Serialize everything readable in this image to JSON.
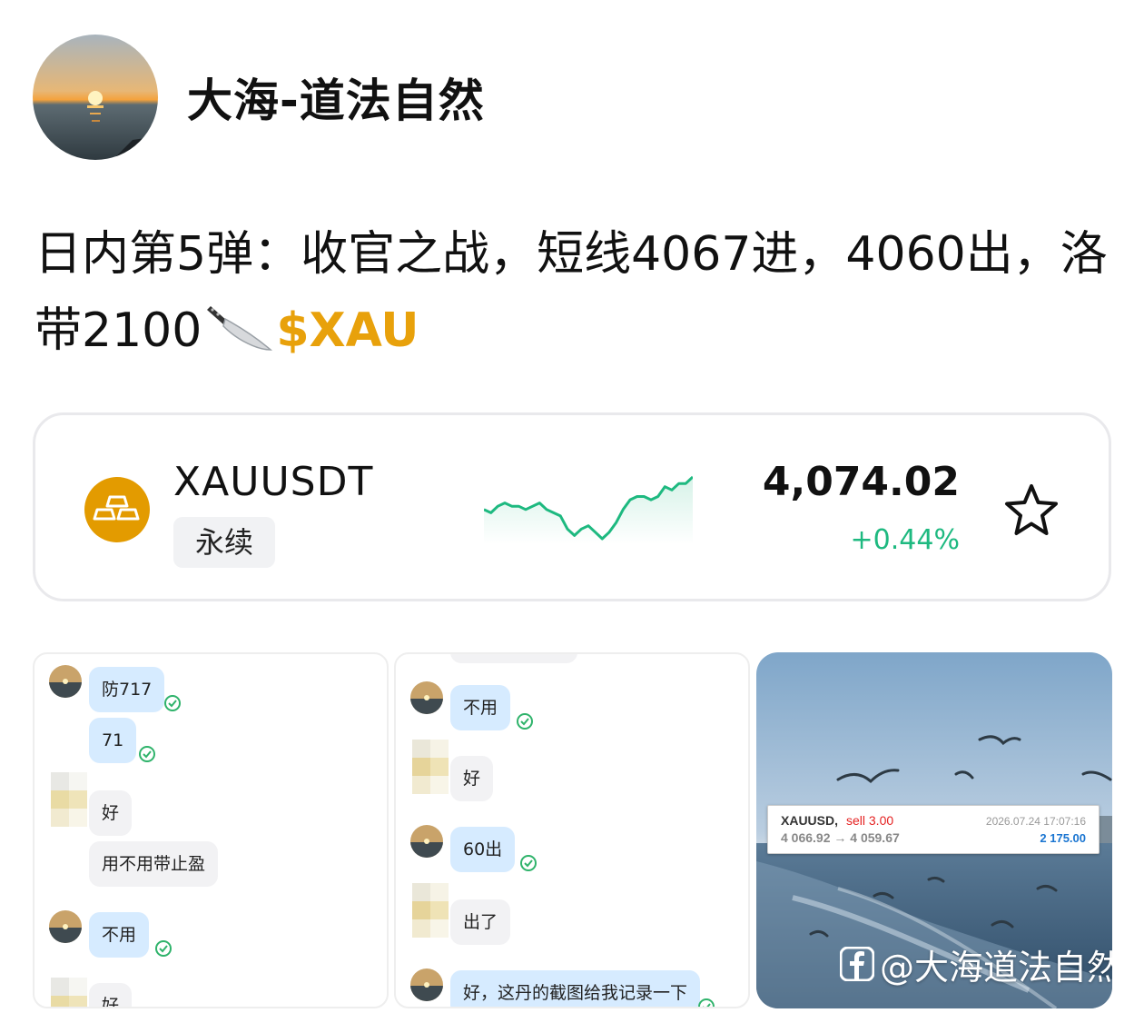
{
  "author": {
    "name": "大海-道法自然",
    "avatar_icon": "sunset-avatar"
  },
  "post": {
    "text": "日内第5弹：收官之战，短线4067进，4060出，洛带2100",
    "emoji": "kitchen-knife-icon",
    "ticker_link": "$XAU"
  },
  "ticker_card": {
    "icon": "gold-bars-icon",
    "symbol": "XAUUSDT",
    "tag": "永续",
    "price": "4,074.02",
    "change": "+0.44%",
    "sparkline_color": "#1eb980",
    "sparkline": [
      4073.6,
      4073.5,
      4073.7,
      4073.8,
      4073.7,
      4073.7,
      4073.6,
      4073.7,
      4073.8,
      4073.6,
      4073.5,
      4073.4,
      4073.0,
      4072.8,
      4073.0,
      4073.1,
      4072.9,
      4072.7,
      4072.9,
      4073.2,
      4073.6,
      4073.9,
      4074.0,
      4074.0,
      4073.9,
      4074.0,
      4074.3,
      4074.2,
      4074.4,
      4074.4,
      4074.6
    ],
    "favorite_icon": "star-icon"
  },
  "images": {
    "chat1": {
      "m1": "防717",
      "m2": "71",
      "m3": "好",
      "m4": "用不用带止盈",
      "m5": "不用",
      "m6": "好"
    },
    "chat2": {
      "m1": "不用",
      "m2": "好",
      "m3": "60出",
      "m4": "出了",
      "m5": "好，这丹的截图给我记录一下"
    },
    "trade": {
      "symbol": "XAUUSD,",
      "side": "sell 3.00",
      "time": "2026.07.24 17:07:16",
      "range": "4 066.92 → 4 059.67",
      "profit": "2 175.00"
    },
    "watermark": "@大海道法自然"
  }
}
